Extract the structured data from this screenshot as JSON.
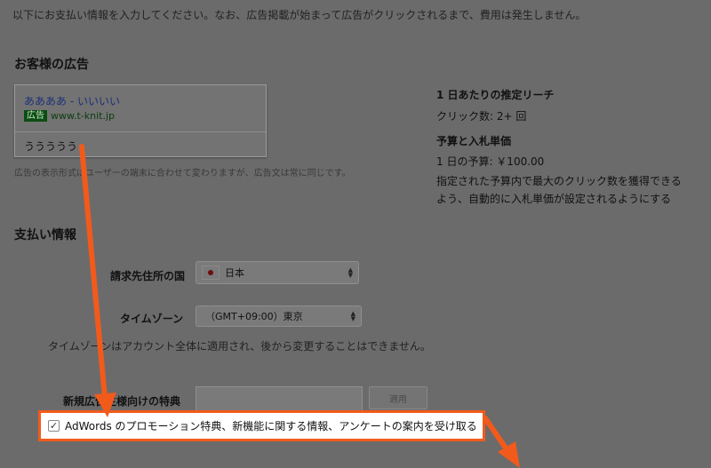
{
  "intro_text": "以下にお支払い情報を入力してください。なお、広告掲載が始まって広告がクリックされるまで、費用は発生しません。",
  "ad_section": {
    "heading": "お客様の広告",
    "preview": {
      "title": "ああああ - いいいい",
      "badge": "広告",
      "url": "www.t-knit.jp",
      "description": "ううううう"
    },
    "note": "広告の表示形式はユーザーの端末に合わせて変わりますが、広告文は常に同じです。"
  },
  "estimate": {
    "reach_heading": "1 日あたりの推定リーチ",
    "clicks": "クリック数: 2+ 回",
    "budget_heading": "予算と入札単価",
    "daily_budget": "1 日の予算: ￥100.00",
    "bid_line1": "指定された予算内で最大のクリック数を獲得できる",
    "bid_line2": "よう、自動的に入札単価が設定されるようにする"
  },
  "payment": {
    "heading": "支払い情報",
    "country_label": "請求先住所の国",
    "country_value": "日本",
    "timezone_label": "タイムゾーン",
    "timezone_value": "（GMT+09:00）東京",
    "timezone_note": "タイムゾーンはアカウント全体に適用され、後から変更することはできません。",
    "promo_label": "新規広告主様向けの特典",
    "promo_value": "",
    "apply_label": "適用",
    "optin_label": "AdWords のプロモーション特典、新機能に関する情報、アンケートの案内を受け取る",
    "optin_checked": true
  },
  "colors": {
    "annotation": "#f25a1c",
    "dim_background": "#6b6b6b"
  }
}
